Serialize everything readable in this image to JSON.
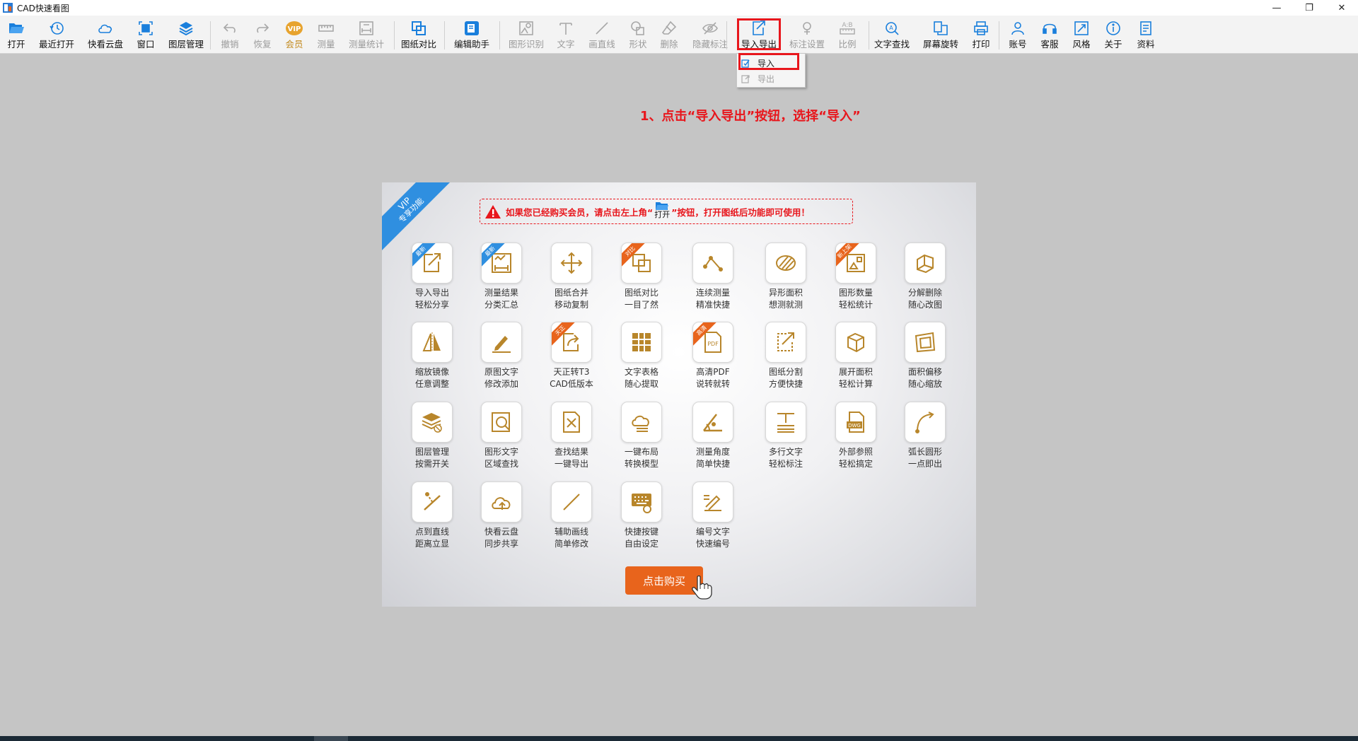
{
  "window": {
    "title": "CAD快速看图",
    "minimize_glyph": "—",
    "restore_glyph": "❐",
    "close_glyph": "✕"
  },
  "toolbar": {
    "buttons": [
      {
        "label": "打开",
        "icon": "folder-open-icon",
        "state": "enabled"
      },
      {
        "label": "最近打开",
        "icon": "history-icon",
        "state": "enabled"
      },
      {
        "label": "快看云盘",
        "icon": "cloud-icon",
        "state": "enabled"
      },
      {
        "label": "窗口",
        "icon": "window-focus-icon",
        "state": "enabled"
      },
      {
        "label": "图层管理",
        "icon": "layers-icon",
        "state": "enabled"
      },
      {
        "label": "撤销",
        "icon": "undo-icon",
        "state": "disabled"
      },
      {
        "label": "恢复",
        "icon": "redo-icon",
        "state": "disabled"
      },
      {
        "label": "会员",
        "icon": "vip-icon",
        "state": "vip"
      },
      {
        "label": "测量",
        "icon": "measure-icon",
        "state": "disabled"
      },
      {
        "label": "测量统计",
        "icon": "measure-stats-icon",
        "state": "disabled"
      },
      {
        "label": "图纸对比",
        "icon": "compare-icon",
        "state": "enabled"
      },
      {
        "label": "编辑助手",
        "icon": "edit-assistant-icon",
        "state": "enabled"
      },
      {
        "label": "图形识别",
        "icon": "shape-recognize-icon",
        "state": "disabled"
      },
      {
        "label": "文字",
        "icon": "text-icon",
        "state": "disabled"
      },
      {
        "label": "画直线",
        "icon": "line-icon",
        "state": "disabled"
      },
      {
        "label": "形状",
        "icon": "shape-icon",
        "state": "disabled"
      },
      {
        "label": "删除",
        "icon": "eraser-icon",
        "state": "disabled"
      },
      {
        "label": "隐藏标注",
        "icon": "hide-eye-icon",
        "state": "disabled"
      },
      {
        "label": "导入导出",
        "icon": "import-export-icon",
        "state": "enabled"
      },
      {
        "label": "标注设置",
        "icon": "annotation-settings-icon",
        "state": "disabled"
      },
      {
        "label": "比例",
        "icon": "scale-icon",
        "state": "disabled"
      },
      {
        "label": "文字查找",
        "icon": "text-search-icon",
        "state": "enabled"
      },
      {
        "label": "屏幕旋转",
        "icon": "rotate-screen-icon",
        "state": "enabled"
      },
      {
        "label": "打印",
        "icon": "printer-icon",
        "state": "enabled"
      },
      {
        "label": "账号",
        "icon": "user-icon",
        "state": "enabled"
      },
      {
        "label": "客服",
        "icon": "headset-icon",
        "state": "enabled"
      },
      {
        "label": "风格",
        "icon": "style-icon",
        "state": "enabled"
      },
      {
        "label": "关于",
        "icon": "info-icon",
        "state": "enabled"
      },
      {
        "label": "资料",
        "icon": "document-icon",
        "state": "enabled"
      }
    ]
  },
  "dropdown": {
    "items": [
      {
        "label": "导入",
        "icon": "import-icon",
        "state": "enabled"
      },
      {
        "label": "导出",
        "icon": "export-icon",
        "state": "disabled"
      }
    ]
  },
  "instruction": "1、点击“导入导出”按钮，选择“导入”",
  "vip_panel": {
    "ribbon_line1": "VIP",
    "ribbon_line2": "专享功能",
    "notice_before": "如果您已经购买会员，请点击左上角“",
    "notice_open_label": "打开",
    "notice_after": "”按钮，打开图纸后功能即可使用！",
    "features": [
      {
        "label": "导入导出\n轻松分享",
        "icon": "import-export-icon",
        "badge": "最新",
        "badge_color": "blue"
      },
      {
        "label": "测量结果\n分类汇总",
        "icon": "measure-summary-icon",
        "badge": "最新",
        "badge_color": "blue"
      },
      {
        "label": "图纸合并\n移动复制",
        "icon": "move-arrows-icon",
        "badge": "",
        "badge_color": ""
      },
      {
        "label": "图纸对比\n一目了然",
        "icon": "compare-icon",
        "badge": "对比",
        "badge_color": "orange"
      },
      {
        "label": "连续测量\n精准快捷",
        "icon": "polyline-measure-icon",
        "badge": "",
        "badge_color": ""
      },
      {
        "label": "异形面积\n想测就测",
        "icon": "hatch-area-icon",
        "badge": "",
        "badge_color": ""
      },
      {
        "label": "图形数量\n轻松统计",
        "icon": "shape-count-icon",
        "badge": "新上架",
        "badge_color": "orange"
      },
      {
        "label": "分解删除\n随心改图",
        "icon": "explode-block-icon",
        "badge": "",
        "badge_color": ""
      },
      {
        "label": "缩放镜像\n任意调整",
        "icon": "mirror-icon",
        "badge": "",
        "badge_color": ""
      },
      {
        "label": "原图文字\n修改添加",
        "icon": "pencil-icon",
        "badge": "",
        "badge_color": ""
      },
      {
        "label": "天正转T3\nCAD低版本",
        "icon": "convert-share-icon",
        "badge": "天正",
        "badge_color": "orange"
      },
      {
        "label": "文字表格\n随心提取",
        "icon": "table-extract-icon",
        "badge": "",
        "badge_color": ""
      },
      {
        "label": "高清PDF\n说转就转",
        "icon": "pdf-icon",
        "badge": "高清",
        "badge_color": "orange"
      },
      {
        "label": "图纸分割\n方便快捷",
        "icon": "split-drawing-icon",
        "badge": "",
        "badge_color": ""
      },
      {
        "label": "展开面积\n轻松计算",
        "icon": "unfold-area-icon",
        "badge": "",
        "badge_color": ""
      },
      {
        "label": "面积偏移\n随心缩放",
        "icon": "area-offset-icon",
        "badge": "",
        "badge_color": ""
      },
      {
        "label": "图层管理\n按需开关",
        "icon": "layers-icon",
        "badge": "",
        "badge_color": ""
      },
      {
        "label": "图形文字\n区域查找",
        "icon": "area-search-icon",
        "badge": "",
        "badge_color": ""
      },
      {
        "label": "查找结果\n一键导出",
        "icon": "export-results-icon",
        "badge": "",
        "badge_color": ""
      },
      {
        "label": "一键布局\n转换模型",
        "icon": "layout-model-icon",
        "badge": "",
        "badge_color": ""
      },
      {
        "label": "测量角度\n简单快捷",
        "icon": "angle-icon",
        "badge": "",
        "badge_color": ""
      },
      {
        "label": "多行文字\n轻松标注",
        "icon": "multiline-text-icon",
        "badge": "",
        "badge_color": ""
      },
      {
        "label": "外部参照\n轻松搞定",
        "icon": "dwg-reference-icon",
        "badge": "",
        "badge_color": ""
      },
      {
        "label": "弧长圆形\n一点即出",
        "icon": "arc-length-icon",
        "badge": "",
        "badge_color": ""
      },
      {
        "label": "点到直线\n距离立显",
        "icon": "point-line-icon",
        "badge": "",
        "badge_color": ""
      },
      {
        "label": "快看云盘\n同步共享",
        "icon": "cloud-sync-icon",
        "badge": "",
        "badge_color": ""
      },
      {
        "label": "辅助画线\n简单修改",
        "icon": "draw-line-icon",
        "badge": "",
        "badge_color": ""
      },
      {
        "label": "快捷按键\n自由设定",
        "icon": "keyboard-icon",
        "badge": "",
        "badge_color": ""
      },
      {
        "label": "编号文字\n快速编号",
        "icon": "number-text-icon",
        "badge": "",
        "badge_color": ""
      }
    ],
    "buy_label": "点击购买"
  },
  "colors": {
    "accent_blue": "#1a7fdc",
    "highlight_red": "#e8161c",
    "vip_gold": "#c28a1e",
    "feature_gold": "#b8862b",
    "buy_orange": "#e8641c"
  }
}
